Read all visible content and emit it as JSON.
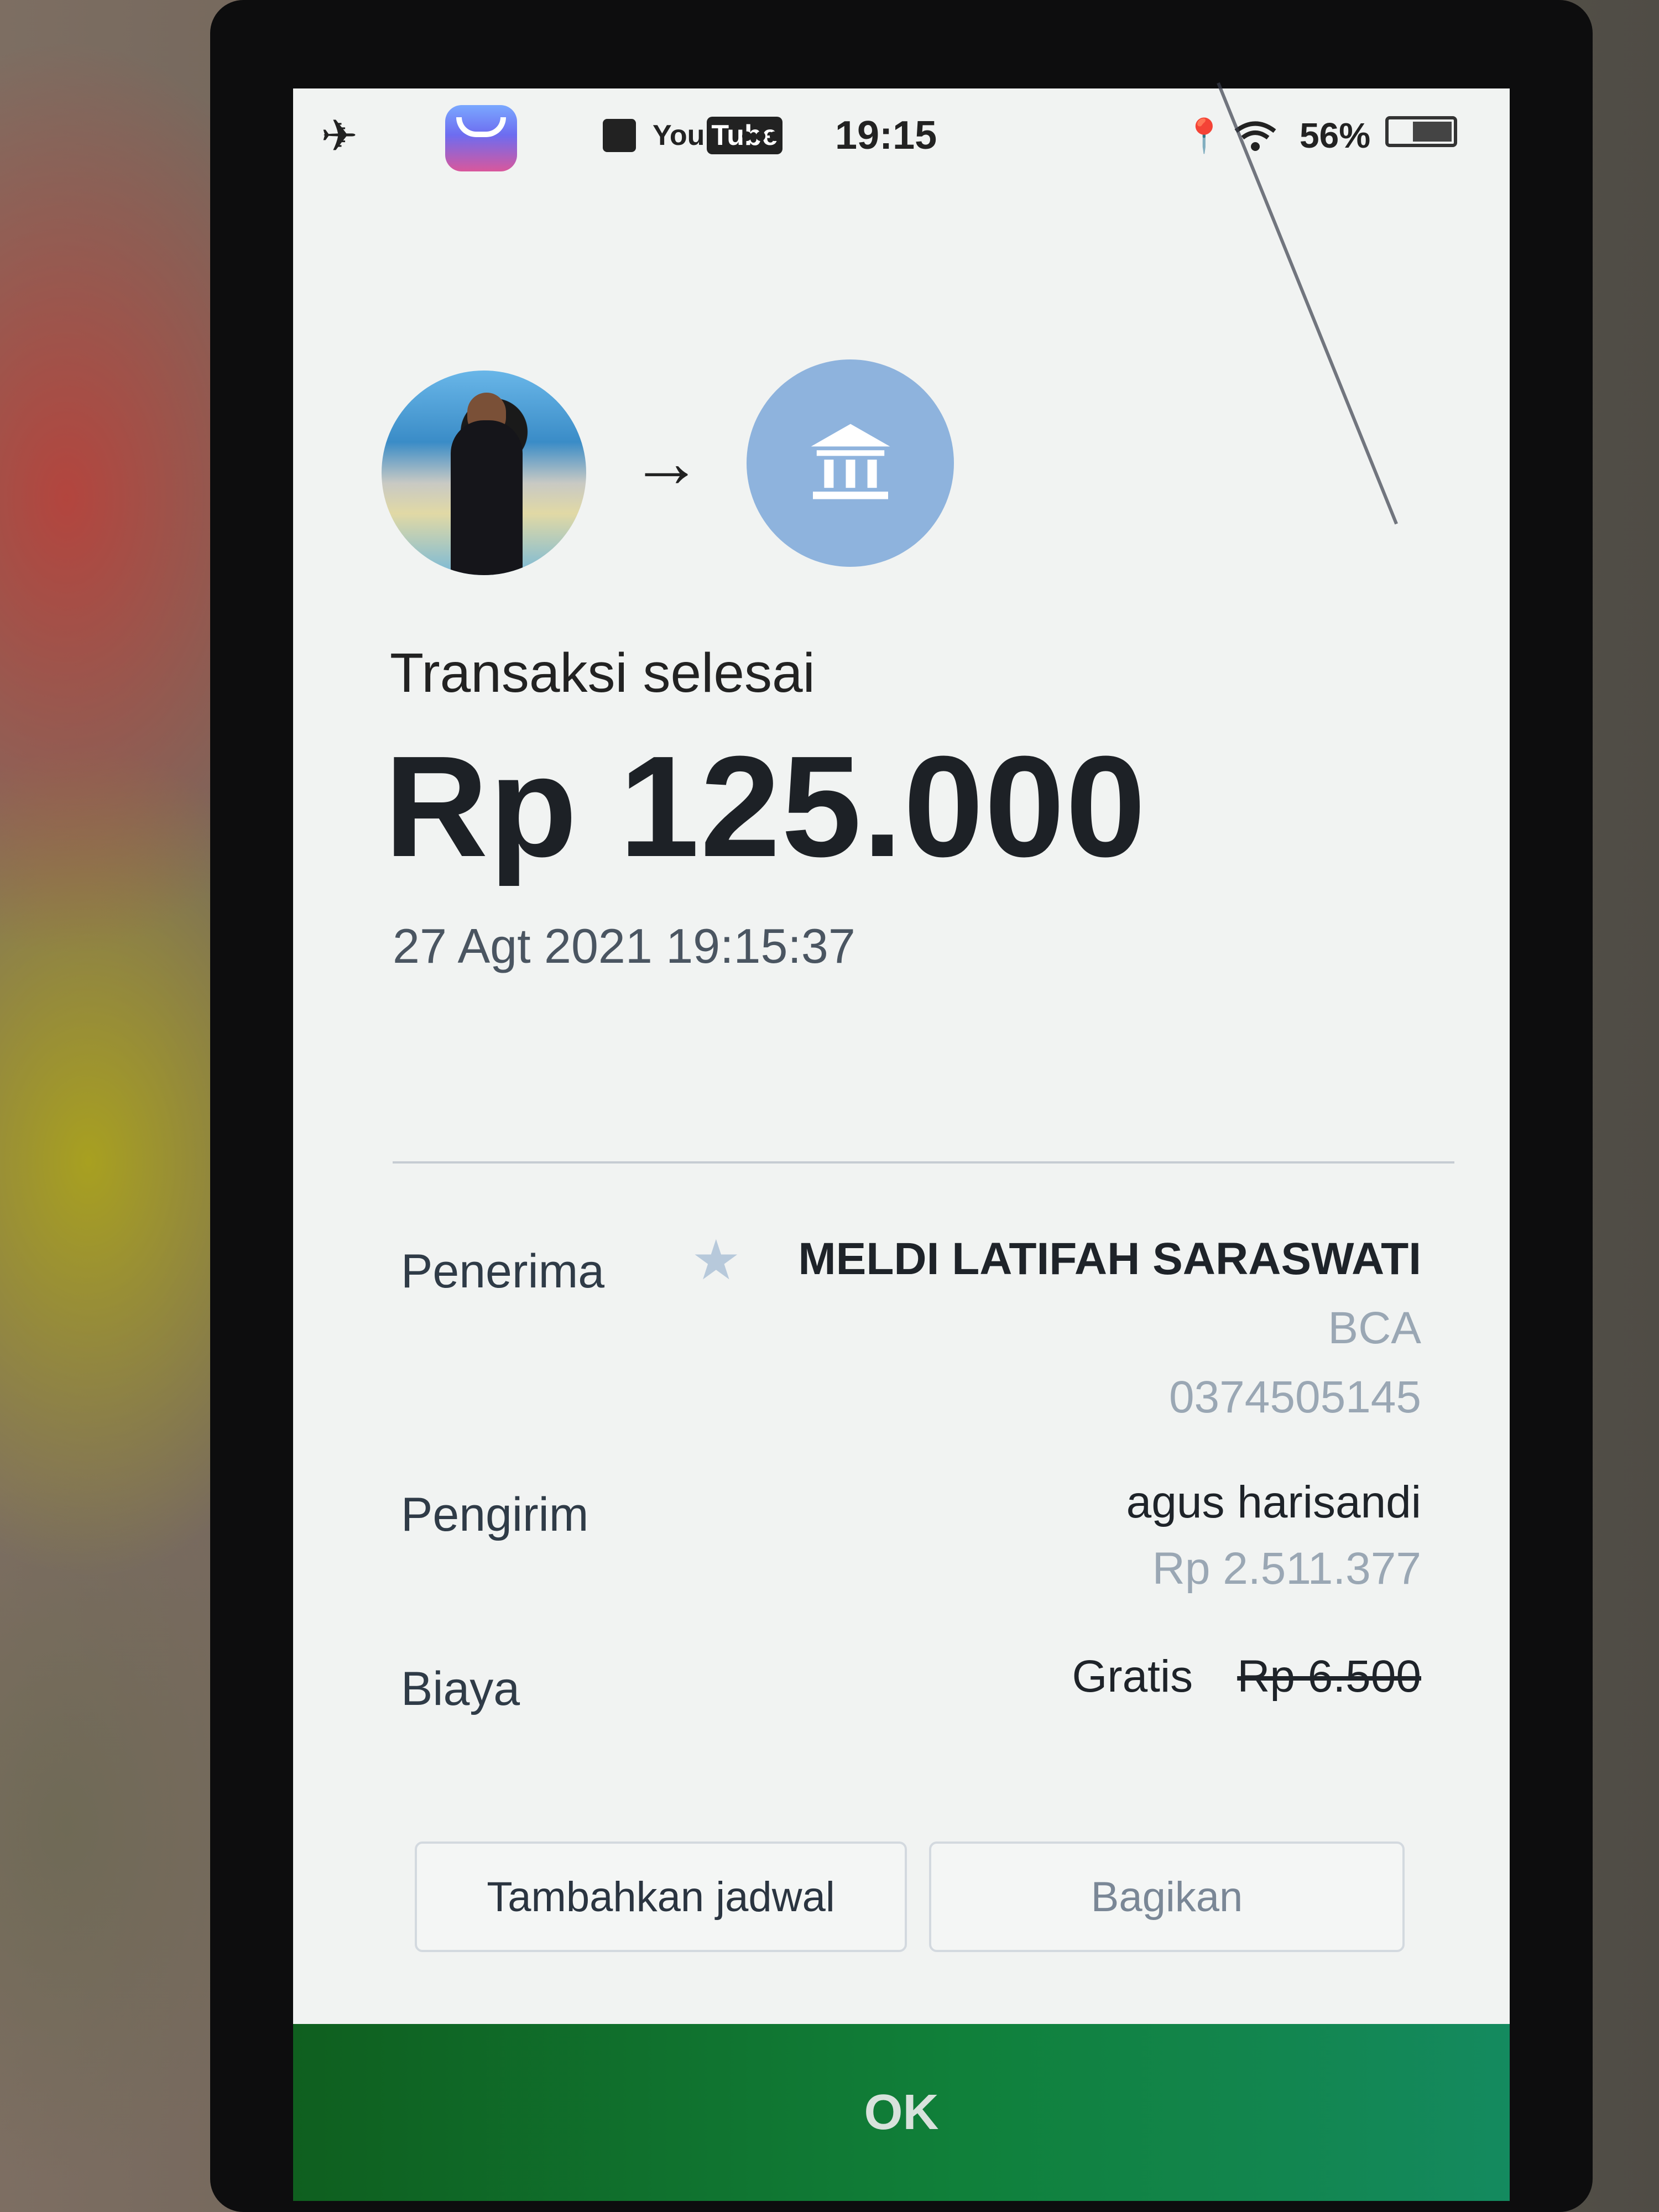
{
  "status_bar": {
    "time": "19:15",
    "battery_percent": "56%",
    "youtube_label": "You",
    "youtube_tube": "Tube",
    "more": "•••",
    "icons": [
      "airplane-icon",
      "app-icon",
      "notification-icon",
      "youtube-icon",
      "location-icon",
      "wifi-icon",
      "battery-icon"
    ]
  },
  "transfer": {
    "status": "Transaksi selesai",
    "amount": "Rp 125.000",
    "datetime": "27 Agt 2021 19:15:37"
  },
  "details": {
    "recipient_label": "Penerima",
    "recipient_name": "MELDI LATIFAH SARASWATI",
    "recipient_bank": "BCA",
    "recipient_account": "0374505145",
    "sender_label": "Pengirim",
    "sender_name": "agus harisandi",
    "sender_balance": "Rp 2.511.377",
    "fee_label": "Biaya",
    "fee_value": "Gratis",
    "fee_original": "Rp 6.500"
  },
  "actions": {
    "schedule_label": "Tambahkan jadwal",
    "share_label": "Bagikan",
    "ok_label": "OK"
  },
  "colors": {
    "ok_button": "#10803a",
    "bank_circle": "#8eb3dd",
    "muted_text": "#9aa7b4"
  }
}
